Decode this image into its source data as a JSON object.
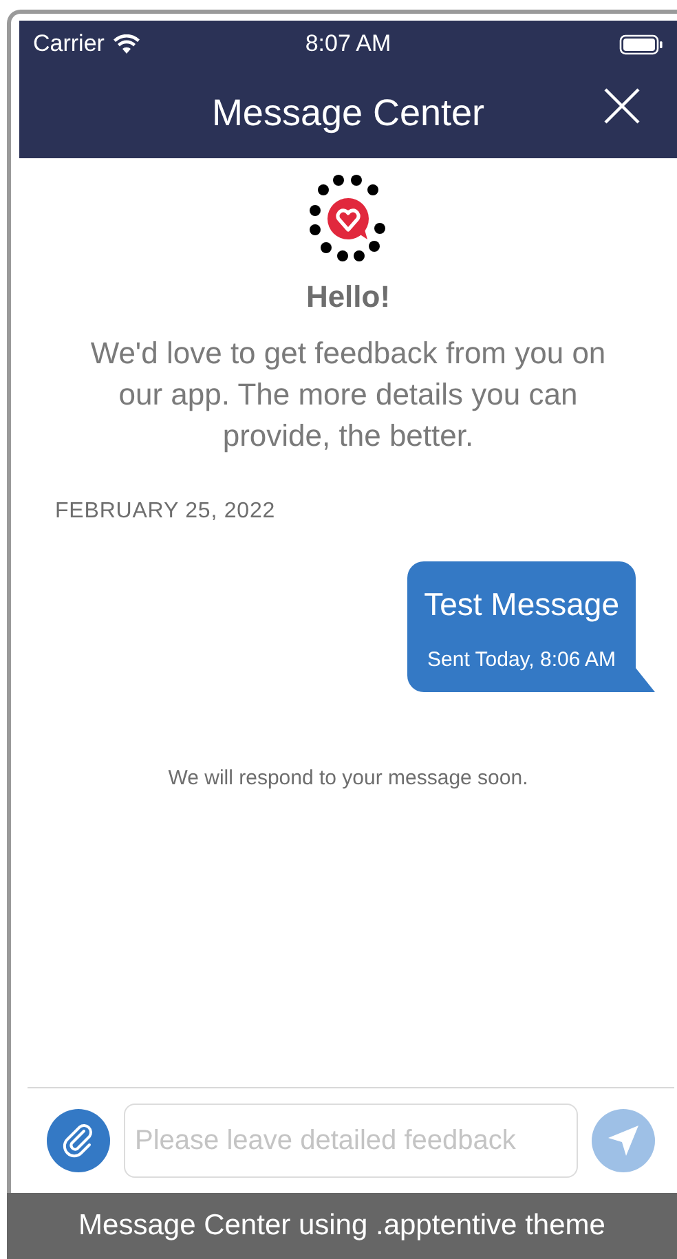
{
  "status_bar": {
    "carrier": "Carrier",
    "time": "8:07 AM"
  },
  "nav_bar": {
    "title": "Message Center"
  },
  "greeting": {
    "title": "Hello!",
    "body": "We'd love to get feedback from you on our app. The more details you can provide, the better."
  },
  "date_header": "FEBRUARY 25, 2022",
  "messages": [
    {
      "text": "Test Message",
      "status": "Sent Today, 8:06 AM"
    }
  ],
  "status_note": "We will respond to your message soon.",
  "composer": {
    "placeholder": "Please leave detailed feedback",
    "send_enabled": false
  },
  "caption": "Message Center using .apptentive theme"
}
